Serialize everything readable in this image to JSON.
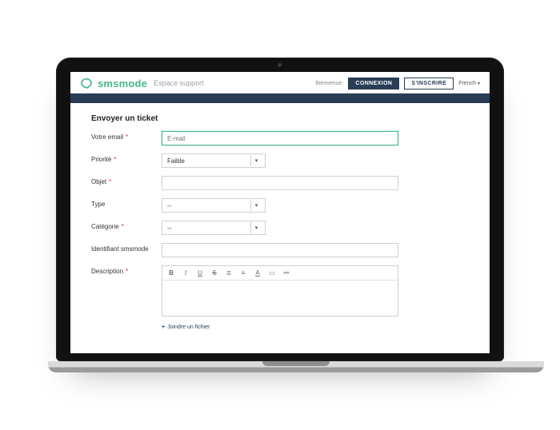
{
  "header": {
    "brand": "smsmode",
    "subtitle": "Espace support",
    "welcome": "Bienvenue",
    "login": "CONNEXION",
    "signup": "S'INSCRIRE",
    "language": "French"
  },
  "form": {
    "title": "Envoyer un ticket",
    "fields": {
      "email": {
        "label": "Votre email",
        "placeholder": "E-mail"
      },
      "priority": {
        "label": "Priorité",
        "value": "Faible"
      },
      "subject": {
        "label": "Objet"
      },
      "type": {
        "label": "Type",
        "value": "--"
      },
      "category": {
        "label": "Catégorie",
        "value": "--"
      },
      "identifier": {
        "label": "Identifiant smsmode"
      },
      "description": {
        "label": "Description"
      }
    },
    "attach": "Joindre un fichier",
    "rt": {
      "bold": "B",
      "italic": "I",
      "underline": "U",
      "strike": "S",
      "bullist": "≣",
      "numlist": "≡",
      "color": "A",
      "image": "▭",
      "link": "⚯"
    }
  }
}
